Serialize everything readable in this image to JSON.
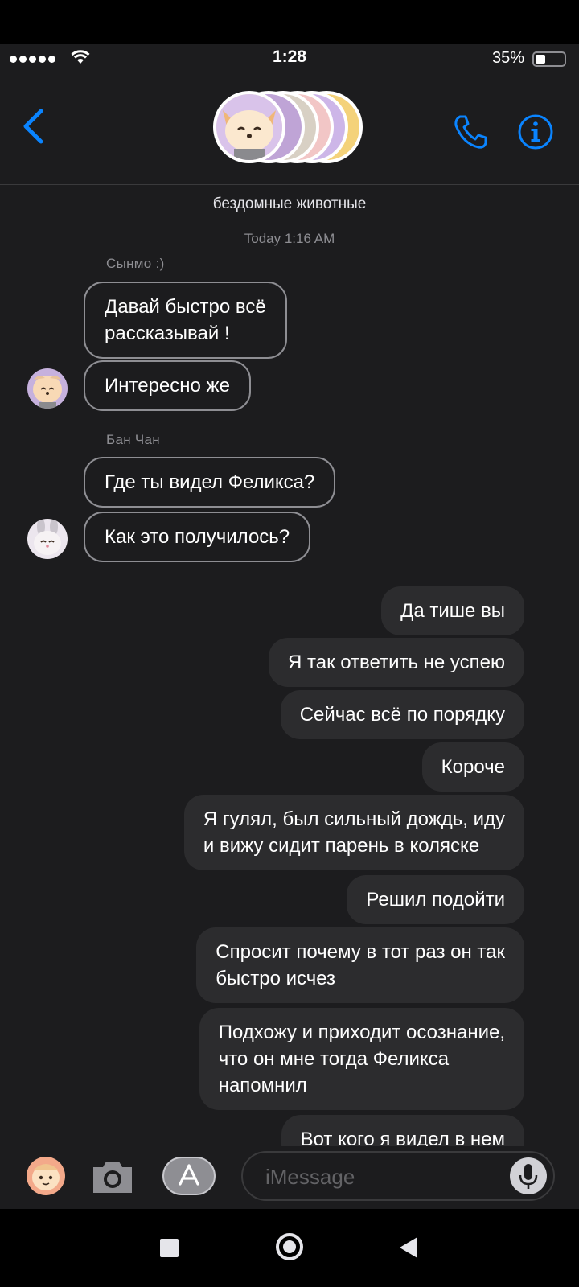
{
  "status": {
    "time": "1:28",
    "battery": "35%"
  },
  "header": {
    "title": "бездомные животные"
  },
  "thread": {
    "timestamp": "Today 1:16 AM",
    "groups": [
      {
        "sender": "Сынмо :)",
        "messages": [
          "Давай быстро всё\nрассказывай !",
          "Интересно же"
        ]
      },
      {
        "sender": "Бан Чан",
        "messages": [
          "Где ты видел Феликса?",
          "Как это получилось?"
        ]
      }
    ],
    "outgoing": [
      "Да тише вы",
      "Я так ответить не успею",
      "Сейчас всё по порядку",
      "Короче",
      "Я гулял, был сильный дождь, иду\nи вижу сидит парень в коляске",
      "Решил подойти",
      "Спросит почему в тот раз он так\nбыстро исчез",
      "Подхожу и приходит осознание,\nчто он мне тогда Феликса\nнапомнил",
      "Вот кого я видел в нем"
    ]
  },
  "composer": {
    "placeholder": "iMessage"
  },
  "icons": {
    "back": "chevron-left-icon",
    "call": "phone-icon",
    "info": "info-icon",
    "camera": "camera-icon",
    "apps": "app-store-icon",
    "mic": "microphone-icon"
  },
  "colors": {
    "accent": "#0a84ff",
    "background": "#1c1c1e",
    "outgoing_bubble": "#2c2c2e",
    "incoming_border": "#8e8e93"
  }
}
